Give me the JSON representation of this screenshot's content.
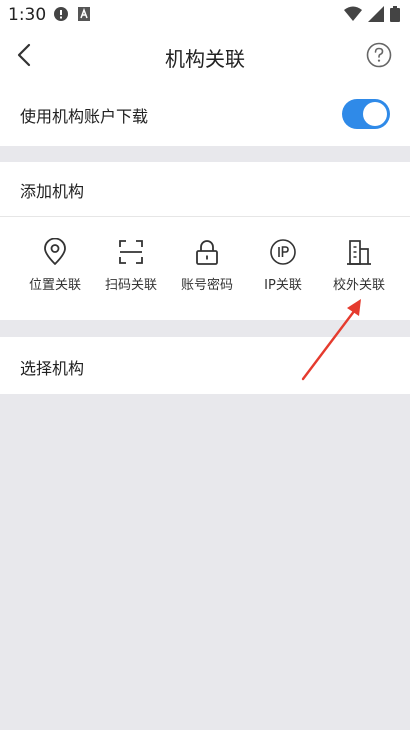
{
  "status": {
    "time": "1:30"
  },
  "nav": {
    "title": "机构关联",
    "back_icon": "chevron-left-icon",
    "help_icon": "help-circle-icon"
  },
  "settings": {
    "use_account_label": "使用机构账户下载",
    "use_account_enabled": true
  },
  "add": {
    "title": "添加机构",
    "methods": [
      {
        "label": "位置关联",
        "icon": "location-pin-icon"
      },
      {
        "label": "扫码关联",
        "icon": "scan-frame-icon"
      },
      {
        "label": "账号密码",
        "icon": "lock-icon"
      },
      {
        "label": "IP关联",
        "icon": "ip-icon"
      },
      {
        "label": "校外关联",
        "icon": "building-icon"
      }
    ]
  },
  "select": {
    "title": "选择机构"
  },
  "colors": {
    "accent": "#2f8ae8",
    "annotation_arrow": "#e53b2e",
    "background": "#e8e8ec"
  }
}
